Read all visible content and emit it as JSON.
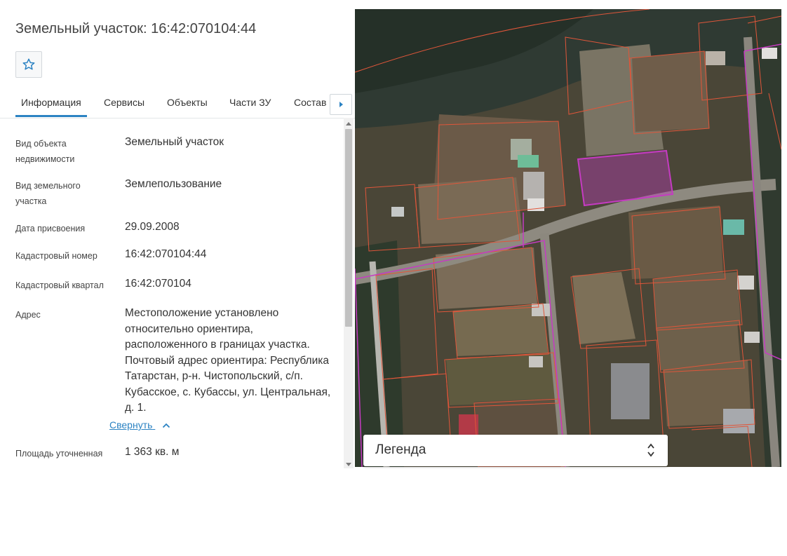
{
  "header": {
    "title": "Земельный участок: 16:42:070104:44"
  },
  "icons": {
    "favorite": "star-outline-icon",
    "tabs_next": "chevron-right-icon",
    "legend_toggle": "chevron-up-down-icon",
    "collapse": "chevron-up-icon"
  },
  "tabs": [
    {
      "label": "Информация",
      "active": true
    },
    {
      "label": "Сервисы"
    },
    {
      "label": "Объекты"
    },
    {
      "label": "Части ЗУ"
    },
    {
      "label": "Состав"
    }
  ],
  "info": {
    "fields": [
      {
        "label": "Вид объекта недвижимости",
        "value": "Земельный участок"
      },
      {
        "label": "Вид земельного участка",
        "value": "Землепользование"
      },
      {
        "label": "Дата присвоения",
        "value": "29.09.2008"
      },
      {
        "label": "Кадастровый номер",
        "value": "16:42:070104:44"
      },
      {
        "label": "Кадастровый квартал",
        "value": "16:42:070104"
      },
      {
        "label": "Адрес",
        "value": "Местоположение установлено относительно ориентира, расположенного в границах участка. Почтовый адрес ориентира: Республика Татарстан, р-н. Чистопольский, с/п. Кубасское, с. Кубассы, ул. Центральная, д. 1."
      },
      {
        "label": "Площадь уточненная",
        "value": "1 363 кв. м"
      }
    ],
    "collapse_label": "Свернуть"
  },
  "map": {
    "legend_label": "Легенда"
  },
  "colors": {
    "accent": "#2c83c3",
    "parcel_border": "#e0563a",
    "selected_parcel": "#c53bc2",
    "district_border": "#c53bc2"
  }
}
